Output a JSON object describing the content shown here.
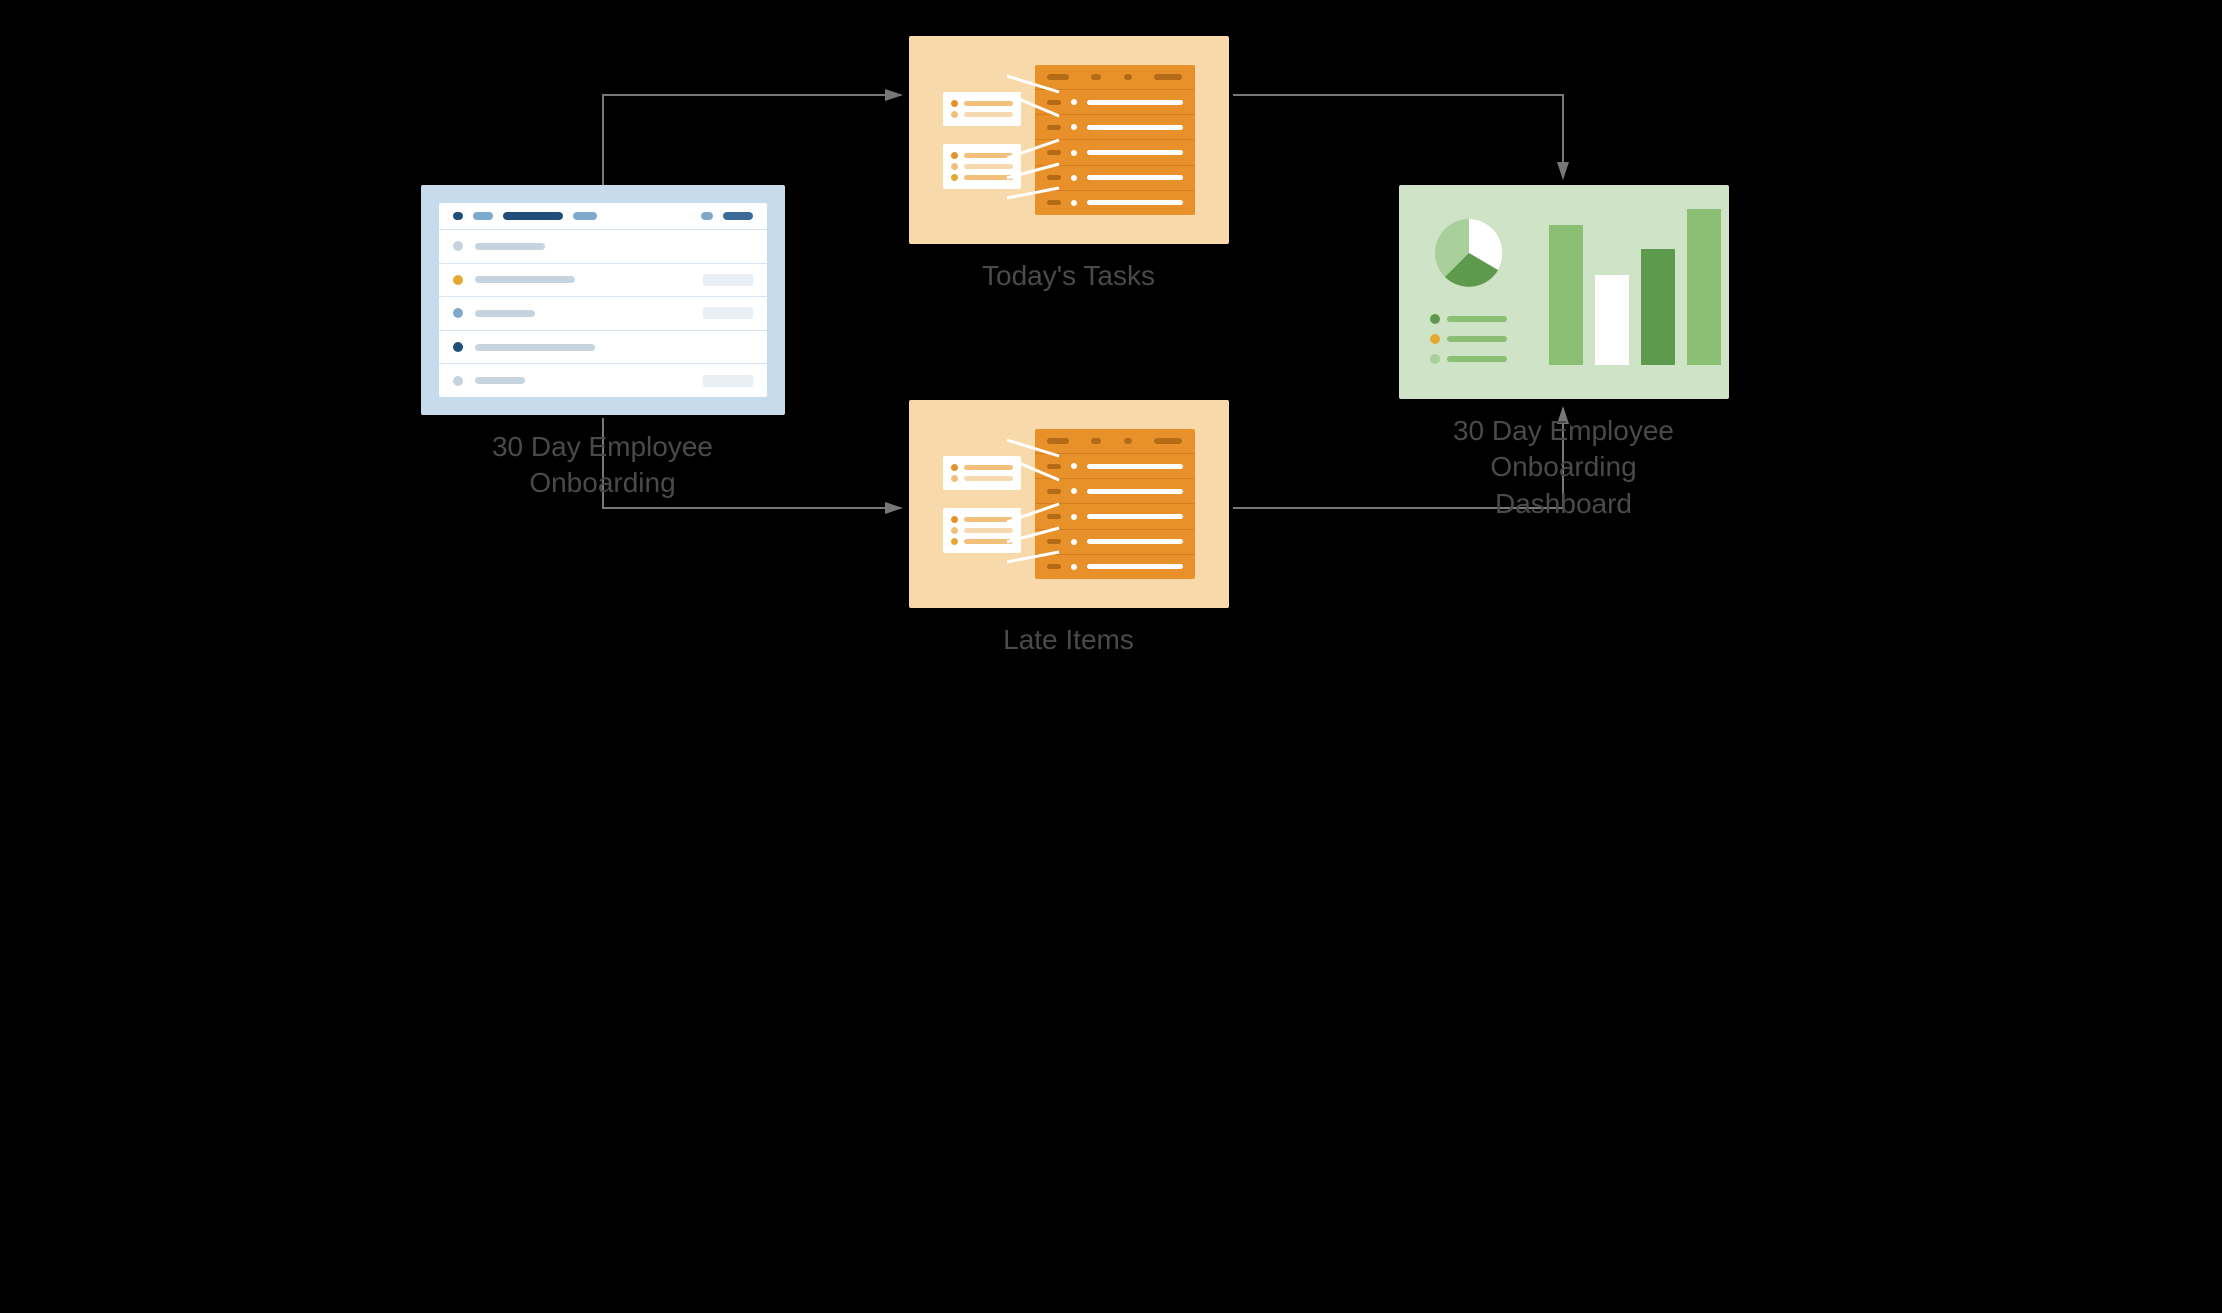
{
  "diagram": {
    "source": {
      "label": "30 Day Employee\nOnboarding",
      "type": "sheet"
    },
    "report_top": {
      "label": "Today's Tasks",
      "type": "report"
    },
    "report_bottom": {
      "label": "Late Items",
      "type": "report"
    },
    "destination": {
      "label": "30 Day Employee\nOnboarding\nDashboard",
      "type": "dashboard"
    },
    "flow": [
      [
        "source",
        "report_top"
      ],
      [
        "source",
        "report_bottom"
      ],
      [
        "report_top",
        "destination"
      ],
      [
        "report_bottom",
        "destination"
      ]
    ]
  },
  "colors": {
    "sheet_bg": "#c6dced",
    "report_bg": "#f8d9a9",
    "report_accent": "#e8912b",
    "dashboard_bg": "#cfe3c7",
    "dashboard_dark": "#5d9a4e",
    "dashboard_mid": "#8abf74",
    "arrow": "#777777"
  }
}
